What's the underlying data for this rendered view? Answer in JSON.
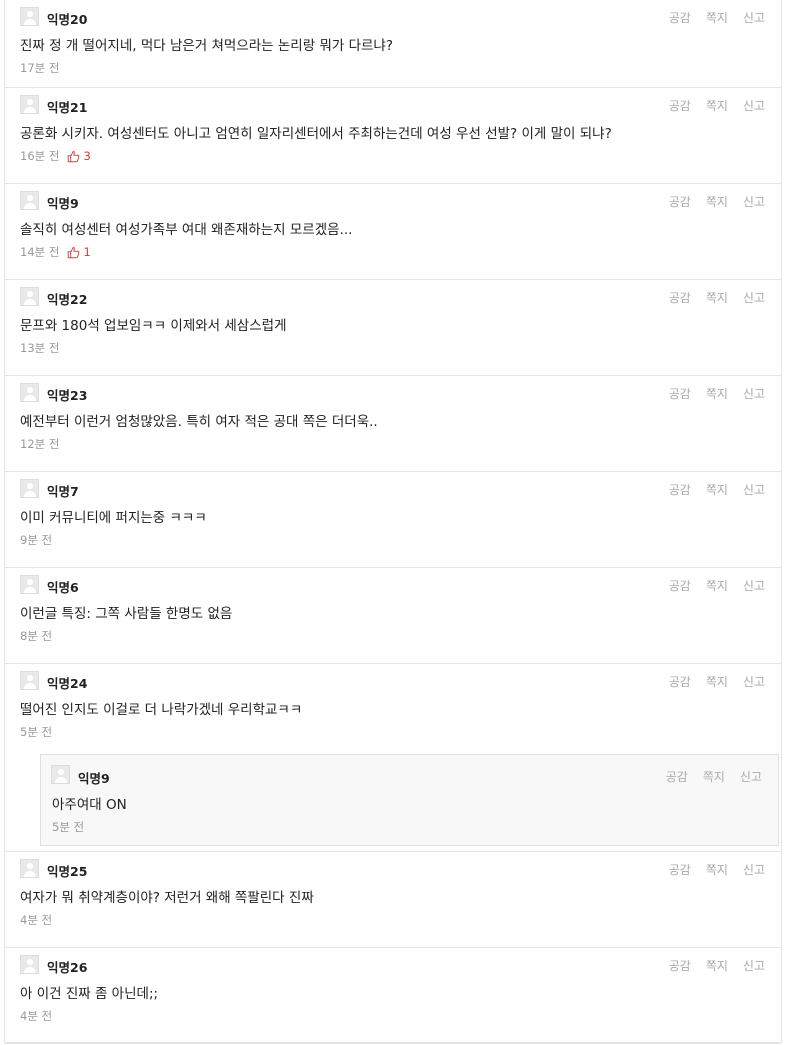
{
  "actions": {
    "like": "공감",
    "message": "쪽지",
    "report": "신고"
  },
  "comments": [
    {
      "nick": "익명20",
      "text": "진짜 정 개 떨어지네, 먹다 남은거 쳐먹으라는 논리랑 뭐가 다르냐?",
      "time": "17분 전",
      "likes": ""
    },
    {
      "nick": "익명21",
      "text": "공론화 시키자. 여성센터도 아니고 엄연히 일자리센터에서 주최하는건데 여성 우선 선발? 이게 말이 되냐?",
      "time": "16분 전",
      "likes": "3"
    },
    {
      "nick": "익명9",
      "text": "솔직히 여성센터 여성가족부 여대 왜존재하는지 모르겠음...",
      "time": "14분 전",
      "likes": "1"
    },
    {
      "nick": "익명22",
      "text": "문프와 180석 업보임ㅋㅋ 이제와서 세삼스럽게",
      "time": "13분 전",
      "likes": ""
    },
    {
      "nick": "익명23",
      "text": "예전부터 이런거 엄청많았음. 특히 여자 적은 공대 쪽은 더더욱..",
      "time": "12분 전",
      "likes": ""
    },
    {
      "nick": "익명7",
      "text": "이미 커뮤니티에 퍼지는중 ㅋㅋㅋ",
      "time": "9분 전",
      "likes": ""
    },
    {
      "nick": "익명6",
      "text": "이런글 특징: 그쪽 사람들 한명도 없음",
      "time": "8분 전",
      "likes": ""
    },
    {
      "nick": "익명24",
      "text": "떨어진 인지도 이걸로 더 나락가겠네 우리학교ㅋㅋ",
      "time": "5분 전",
      "likes": ""
    },
    {
      "nick": "익명25",
      "text": "여자가 뭐 취약계층이야? 저런거 왜해 쪽팔린다 진짜",
      "time": "4분 전",
      "likes": ""
    },
    {
      "nick": "익명26",
      "text": "아 이건 진짜 좀 아닌데;;",
      "time": "4분 전",
      "likes": ""
    }
  ],
  "reply": {
    "nick": "익명9",
    "text": "아주여대 ON",
    "time": "5분 전"
  },
  "colors": {
    "like_red": "#e0393e",
    "muted": "#999999",
    "border": "#e4e4e4"
  }
}
